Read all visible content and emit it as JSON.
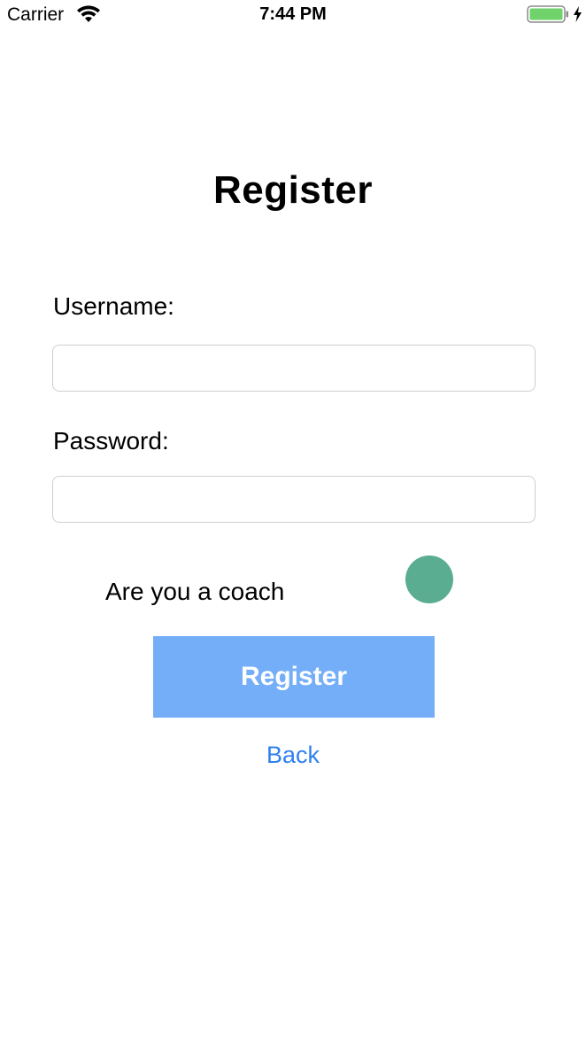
{
  "status_bar": {
    "carrier": "Carrier",
    "time": "7:44 PM",
    "icons": [
      "wifi-icon",
      "battery-icon",
      "charging-icon"
    ],
    "battery_color": "#6fd26a"
  },
  "title": "Register",
  "form": {
    "username_label": "Username:",
    "username_value": "",
    "username_placeholder": "",
    "password_label": "Password:",
    "password_value": "",
    "password_placeholder": "",
    "coach_label": "Are you a coach",
    "coach_toggle_color": "#5aad91"
  },
  "actions": {
    "register_label": "Register",
    "register_color": "#75aef8",
    "back_label": "Back",
    "back_color": "#2f80ed"
  }
}
